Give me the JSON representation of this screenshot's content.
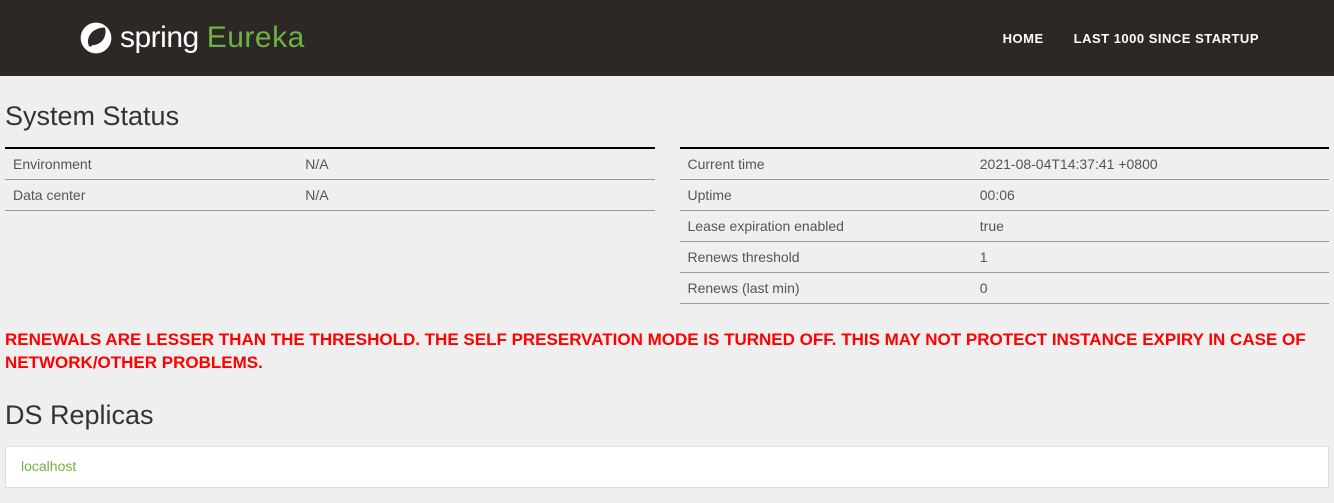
{
  "brand": {
    "spring": "spring",
    "eureka": "Eureka"
  },
  "nav": {
    "home": "HOME",
    "last1000": "LAST 1000 SINCE STARTUP"
  },
  "sections": {
    "system_status": "System Status",
    "ds_replicas": "DS Replicas"
  },
  "status_left": [
    {
      "label": "Environment",
      "value": "N/A"
    },
    {
      "label": "Data center",
      "value": "N/A"
    }
  ],
  "status_right": [
    {
      "label": "Current time",
      "value": "2021-08-04T14:37:41 +0800"
    },
    {
      "label": "Uptime",
      "value": "00:06"
    },
    {
      "label": "Lease expiration enabled",
      "value": "true"
    },
    {
      "label": "Renews threshold",
      "value": "1"
    },
    {
      "label": "Renews (last min)",
      "value": "0"
    }
  ],
  "warning_message": "RENEWALS ARE LESSER THAN THE THRESHOLD. THE SELF PRESERVATION MODE IS TURNED OFF. THIS MAY NOT PROTECT INSTANCE EXPIRY IN CASE OF NETWORK/OTHER PROBLEMS.",
  "replicas": [
    "localhost"
  ]
}
